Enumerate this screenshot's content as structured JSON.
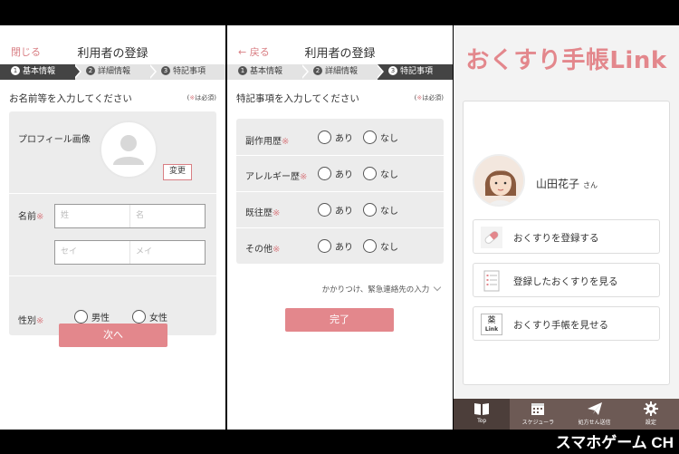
{
  "panel1": {
    "nav_left": "閉じる",
    "title": "利用者の登録",
    "steps": [
      {
        "num": "1",
        "label": "基本情報"
      },
      {
        "num": "2",
        "label": "詳細情報"
      },
      {
        "num": "3",
        "label": "特記事項"
      }
    ],
    "active_step": 0,
    "section_heading": "お名前等を入力してください",
    "required_note_star": "※",
    "required_note": "は必須",
    "profile_label": "プロフィール画像",
    "change_button": "変更",
    "name_label": "名前",
    "required_mark": "※",
    "last_name_placeholder": "姓",
    "first_name_placeholder": "名",
    "last_kana_placeholder": "セイ",
    "first_kana_placeholder": "メイ",
    "gender_label": "性別",
    "gender_options": [
      "男性",
      "女性"
    ],
    "next_button": "次へ"
  },
  "panel2": {
    "nav_left": "← 戻る",
    "title": "利用者の登録",
    "active_step": 2,
    "section_heading": "特記事項を入力してください",
    "rows": [
      {
        "label": "副作用歴",
        "yes": "あり",
        "no": "なし"
      },
      {
        "label": "アレルギー歴",
        "yes": "あり",
        "no": "なし"
      },
      {
        "label": "既往歴",
        "yes": "あり",
        "no": "なし"
      },
      {
        "label": "その他",
        "yes": "あり",
        "no": "なし"
      }
    ],
    "expand_link": "かかりつけ、緊急連絡先の入力",
    "done_button": "完了"
  },
  "panel3": {
    "brand": "おくすり手帳Link",
    "user_name": "山田花子",
    "user_suffix": "さん",
    "menu": [
      {
        "label": "おくすりを登録する",
        "icon": "pill-icon"
      },
      {
        "label": "登録したおくすりを見る",
        "icon": "list-icon"
      },
      {
        "label": "おくすり手帳を見せる",
        "icon": "notebook-link-icon"
      }
    ],
    "notebook_icon_text": "Link",
    "notebook_icon_kanji": "薬",
    "tabs": [
      {
        "label": "Top",
        "icon": "book-icon"
      },
      {
        "label": "スケジューラ",
        "icon": "calendar-icon"
      },
      {
        "label": "処方せん送信",
        "icon": "send-icon"
      },
      {
        "label": "設定",
        "icon": "gear-icon"
      }
    ],
    "active_tab": 0
  },
  "watermark": "スマホゲーム CH",
  "colors": {
    "accent": "#e3878c",
    "nav_link": "#d97f84",
    "tabbar": "#6d5a55"
  }
}
